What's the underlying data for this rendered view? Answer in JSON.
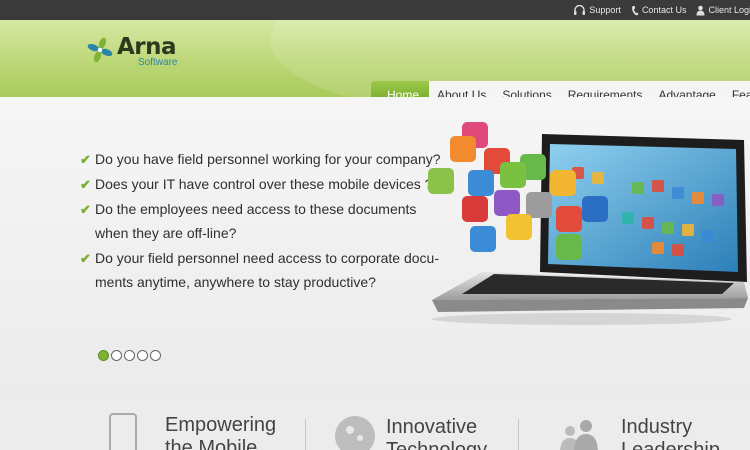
{
  "topbar": {
    "support": "Support",
    "contact": "Contact Us",
    "client_login": "Client Login"
  },
  "logo": {
    "name": "Arna",
    "sub": "Software"
  },
  "nav": {
    "items": [
      "Home",
      "About Us",
      "Solutions",
      "Requirements",
      "Advantage",
      "Features"
    ],
    "active": "Home"
  },
  "hero": {
    "q1": "Do you have field personnel working for your company?",
    "q2": "Does your IT have control over these mobile devices ?",
    "q3_line1": "Do the employees need access to these documents",
    "q3_line2": "when they are off-line?",
    "q4_line1": "Do your field personnel need access to corporate docu-",
    "q4_line2": "ments anytime, anywhere to stay productive?",
    "slides": 5,
    "active_slide": 1
  },
  "features": {
    "f1_line1": "Empowering",
    "f1_line2": "the Mobile",
    "f2_line1": "Innovative",
    "f2_line2": "Technology",
    "f3_line1": "Industry",
    "f3_line2": "Leadership"
  },
  "colors": {
    "accent": "#7eb336",
    "topbar": "#3a3a3a",
    "header": "#bcd777"
  }
}
